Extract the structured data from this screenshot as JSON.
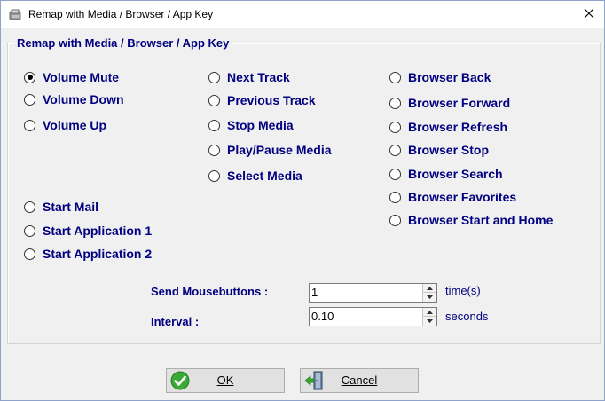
{
  "window": {
    "title": "Remap with Media / Browser / App Key",
    "close_glyph": "✕"
  },
  "group": {
    "title": "Remap with Media / Browser / App Key"
  },
  "options": {
    "volume_mute": "Volume Mute",
    "volume_down": "Volume Down",
    "volume_up": "Volume Up",
    "start_mail": "Start Mail",
    "start_app1": "Start Application 1",
    "start_app2": "Start Application 2",
    "next_track": "Next Track",
    "previous_track": "Previous Track",
    "stop_media": "Stop Media",
    "play_pause_media": "Play/Pause Media",
    "select_media": "Select Media",
    "browser_back": "Browser Back",
    "browser_forward": "Browser Forward",
    "browser_refresh": "Browser Refresh",
    "browser_stop": "Browser Stop",
    "browser_search": "Browser Search",
    "browser_favorites": "Browser Favorites",
    "browser_start_home": "Browser Start and Home",
    "selected": "volume_mute"
  },
  "send_mousebuttons": {
    "label": "Send Mousebuttons :",
    "value": "1",
    "unit": "time(s)"
  },
  "interval": {
    "label": "Interval  :",
    "value": "0.10",
    "unit": "seconds"
  },
  "buttons": {
    "ok": "OK",
    "cancel": "Cancel"
  },
  "colors": {
    "label_text": "#000080",
    "ok_icon": "#3aa935",
    "cancel_icon": "#3aa935"
  },
  "icons": {
    "app": "app-icon",
    "close": "close-icon",
    "ok": "ok-check-icon",
    "cancel": "exit-door-icon"
  }
}
